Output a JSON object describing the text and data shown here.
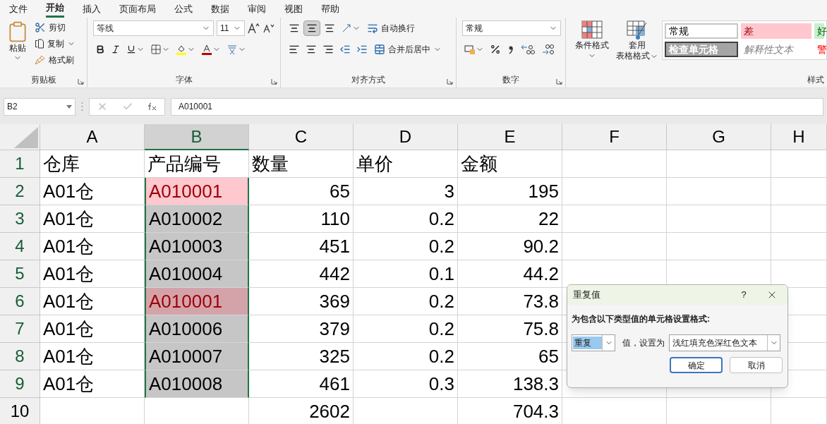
{
  "menu_tabs": [
    {
      "label": "文件",
      "selected": false
    },
    {
      "label": "开始",
      "selected": true
    },
    {
      "label": "插入",
      "selected": false
    },
    {
      "label": "页面布局",
      "selected": false
    },
    {
      "label": "公式",
      "selected": false
    },
    {
      "label": "数据",
      "selected": false
    },
    {
      "label": "审阅",
      "selected": false
    },
    {
      "label": "视图",
      "selected": false
    },
    {
      "label": "帮助",
      "selected": false
    }
  ],
  "ribbon": {
    "clipboard": {
      "title": "剪贴板",
      "paste": "粘贴",
      "cut": "剪切",
      "copy": "复制",
      "format_painter": "格式刷"
    },
    "font": {
      "title": "字体",
      "font_name": "等线",
      "font_size": "11"
    },
    "alignment": {
      "title": "对齐方式",
      "wrap_text": "自动换行",
      "merge_center": "合并后居中"
    },
    "number": {
      "title": "数字",
      "format": "常规"
    },
    "styles": {
      "title": "样式",
      "conditional_format": "条件格式",
      "table_format": [
        "套用",
        "表格格式"
      ],
      "cells": [
        {
          "label": "常规",
          "kind": "normal"
        },
        {
          "label": "差",
          "kind": "bad"
        },
        {
          "label": "好",
          "kind": "good"
        },
        {
          "label": "检查单元格",
          "kind": "check"
        },
        {
          "label": "解释性文本",
          "kind": "explanatory"
        },
        {
          "label": "警",
          "kind": "warning"
        }
      ]
    }
  },
  "formula_bar": {
    "name_box": "B2",
    "formula": "A010001"
  },
  "sheet": {
    "columns": [
      {
        "label": "A",
        "selected": false
      },
      {
        "label": "B",
        "selected": true
      },
      {
        "label": "C",
        "selected": false
      },
      {
        "label": "D",
        "selected": false
      },
      {
        "label": "E",
        "selected": false
      },
      {
        "label": "F",
        "selected": false
      },
      {
        "label": "G",
        "selected": false
      },
      {
        "label": "H",
        "selected": false
      }
    ],
    "rows": [
      {
        "label": "1",
        "selected": true,
        "cells": [
          {
            "text": "仓库",
            "kind": "text",
            "selected": false,
            "duplicate": false
          },
          {
            "text": "产品编号",
            "kind": "text",
            "selected": false,
            "duplicate": false
          },
          {
            "text": "数量",
            "kind": "text",
            "selected": false,
            "duplicate": false
          },
          {
            "text": "单价",
            "kind": "text",
            "selected": false,
            "duplicate": false
          },
          {
            "text": "金额",
            "kind": "text",
            "selected": false,
            "duplicate": false
          }
        ]
      },
      {
        "label": "2",
        "selected": true,
        "cells": [
          {
            "text": "A01仓",
            "kind": "text",
            "selected": false,
            "duplicate": false
          },
          {
            "text": "A010001",
            "kind": "text",
            "selected": true,
            "active": true,
            "duplicate": true
          },
          {
            "text": "65",
            "kind": "number",
            "selected": false,
            "duplicate": false
          },
          {
            "text": "3",
            "kind": "number",
            "selected": false,
            "duplicate": false
          },
          {
            "text": "195",
            "kind": "number",
            "selected": false,
            "duplicate": false
          }
        ]
      },
      {
        "label": "3",
        "selected": true,
        "cells": [
          {
            "text": "A01仓",
            "kind": "text",
            "selected": false,
            "duplicate": false
          },
          {
            "text": "A010002",
            "kind": "text",
            "selected": true,
            "duplicate": false
          },
          {
            "text": "110",
            "kind": "number",
            "selected": false,
            "duplicate": false
          },
          {
            "text": "0.2",
            "kind": "number",
            "selected": false,
            "duplicate": false
          },
          {
            "text": "22",
            "kind": "number",
            "selected": false,
            "duplicate": false
          }
        ]
      },
      {
        "label": "4",
        "selected": true,
        "cells": [
          {
            "text": "A01仓",
            "kind": "text",
            "selected": false,
            "duplicate": false
          },
          {
            "text": "A010003",
            "kind": "text",
            "selected": true,
            "duplicate": false
          },
          {
            "text": "451",
            "kind": "number",
            "selected": false,
            "duplicate": false
          },
          {
            "text": "0.2",
            "kind": "number",
            "selected": false,
            "duplicate": false
          },
          {
            "text": "90.2",
            "kind": "number",
            "selected": false,
            "duplicate": false
          }
        ]
      },
      {
        "label": "5",
        "selected": true,
        "cells": [
          {
            "text": "A01仓",
            "kind": "text",
            "selected": false,
            "duplicate": false
          },
          {
            "text": "A010004",
            "kind": "text",
            "selected": true,
            "duplicate": false
          },
          {
            "text": "442",
            "kind": "number",
            "selected": false,
            "duplicate": false
          },
          {
            "text": "0.1",
            "kind": "number",
            "selected": false,
            "duplicate": false
          },
          {
            "text": "44.2",
            "kind": "number",
            "selected": false,
            "duplicate": false
          }
        ]
      },
      {
        "label": "6",
        "selected": true,
        "cells": [
          {
            "text": "A01仓",
            "kind": "text",
            "selected": false,
            "duplicate": false
          },
          {
            "text": "A010001",
            "kind": "text",
            "selected": true,
            "duplicate": true
          },
          {
            "text": "369",
            "kind": "number",
            "selected": false,
            "duplicate": false
          },
          {
            "text": "0.2",
            "kind": "number",
            "selected": false,
            "duplicate": false
          },
          {
            "text": "73.8",
            "kind": "number",
            "selected": false,
            "duplicate": false
          }
        ]
      },
      {
        "label": "7",
        "selected": true,
        "cells": [
          {
            "text": "A01仓",
            "kind": "text",
            "selected": false,
            "duplicate": false
          },
          {
            "text": "A010006",
            "kind": "text",
            "selected": true,
            "duplicate": false
          },
          {
            "text": "379",
            "kind": "number",
            "selected": false,
            "duplicate": false
          },
          {
            "text": "0.2",
            "kind": "number",
            "selected": false,
            "duplicate": false
          },
          {
            "text": "75.8",
            "kind": "number",
            "selected": false,
            "duplicate": false
          }
        ]
      },
      {
        "label": "8",
        "selected": true,
        "cells": [
          {
            "text": "A01仓",
            "kind": "text",
            "selected": false,
            "duplicate": false
          },
          {
            "text": "A010007",
            "kind": "text",
            "selected": true,
            "duplicate": false
          },
          {
            "text": "325",
            "kind": "number",
            "selected": false,
            "duplicate": false
          },
          {
            "text": "0.2",
            "kind": "number",
            "selected": false,
            "duplicate": false
          },
          {
            "text": "65",
            "kind": "number",
            "selected": false,
            "duplicate": false
          }
        ]
      },
      {
        "label": "9",
        "selected": true,
        "cells": [
          {
            "text": "A01仓",
            "kind": "text",
            "selected": false,
            "duplicate": false
          },
          {
            "text": "A010008",
            "kind": "text",
            "selected": true,
            "duplicate": false
          },
          {
            "text": "461",
            "kind": "number",
            "selected": false,
            "duplicate": false
          },
          {
            "text": "0.3",
            "kind": "number",
            "selected": false,
            "duplicate": false
          },
          {
            "text": "138.3",
            "kind": "number",
            "selected": false,
            "duplicate": false
          }
        ]
      },
      {
        "label": "10",
        "selected": false,
        "cells": [
          null,
          null,
          {
            "text": "2602",
            "kind": "number",
            "selected": false,
            "duplicate": false
          },
          null,
          {
            "text": "704.3",
            "kind": "number",
            "selected": false,
            "duplicate": false
          }
        ]
      }
    ]
  },
  "dialog": {
    "title": "重复值",
    "help": "?",
    "prompt": "为包含以下类型值的单元格设置格式:",
    "rule": "重复",
    "rule_label": "值，设置为",
    "format": "浅红填充色深红色文本",
    "buttons": [
      {
        "label": "确定",
        "primary": true
      },
      {
        "label": "取消",
        "primary": false
      }
    ]
  }
}
